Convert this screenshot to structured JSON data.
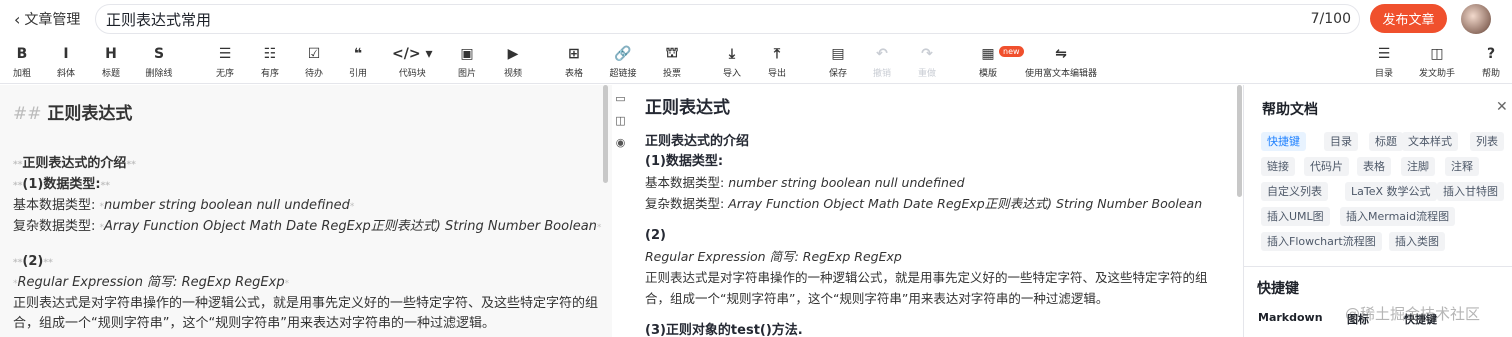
{
  "header": {
    "back_label": "文章管理",
    "title_value": "正则表达式常用",
    "char_count": "7/100",
    "publish_label": "发布文章"
  },
  "toolbar": {
    "items": [
      {
        "icon": "B",
        "label": "加粗",
        "icon_name": "bold-icon"
      },
      {
        "icon": "I",
        "label": "斜体",
        "icon_name": "italic-icon"
      },
      {
        "icon": "H",
        "label": "标题",
        "icon_name": "heading-icon"
      },
      {
        "icon": "S",
        "label": "删除线",
        "icon_name": "strikethrough-icon"
      },
      {
        "icon": "☰",
        "label": "无序",
        "icon_name": "unordered-list-icon"
      },
      {
        "icon": "☷",
        "label": "有序",
        "icon_name": "ordered-list-icon"
      },
      {
        "icon": "☑",
        "label": "待办",
        "icon_name": "todo-list-icon"
      },
      {
        "icon": "❝",
        "label": "引用",
        "icon_name": "quote-icon"
      },
      {
        "icon": "</> ▾",
        "label": "代码块",
        "icon_name": "code-block-icon"
      },
      {
        "icon": "▣",
        "label": "图片",
        "icon_name": "image-icon"
      },
      {
        "icon": "▶",
        "label": "视频",
        "icon_name": "video-icon"
      },
      {
        "icon": "⊞",
        "label": "表格",
        "icon_name": "table-icon"
      },
      {
        "icon": "🔗",
        "label": "超链接",
        "icon_name": "link-icon"
      },
      {
        "icon": "⛫",
        "label": "投票",
        "icon_name": "vote-icon"
      },
      {
        "icon": "⤓",
        "label": "导入",
        "icon_name": "import-icon"
      },
      {
        "icon": "⤒",
        "label": "导出",
        "icon_name": "export-icon"
      },
      {
        "icon": "▤",
        "label": "保存",
        "icon_name": "save-icon"
      },
      {
        "icon": "↶",
        "label": "撤销",
        "icon_name": "undo-icon"
      },
      {
        "icon": "↷",
        "label": "重做",
        "icon_name": "redo-icon"
      },
      {
        "icon": "▦",
        "label": "模版",
        "icon_name": "template-icon"
      },
      {
        "icon": "⇋",
        "label": "使用富文本编辑器",
        "icon_name": "rich-text-icon"
      },
      {
        "icon": "☰",
        "label": "目录",
        "icon_name": "toc-icon"
      },
      {
        "icon": "◫",
        "label": "发文助手",
        "icon_name": "assistant-icon"
      },
      {
        "icon": "?",
        "label": "帮助",
        "icon_name": "help-icon"
      }
    ],
    "new_badge": "new"
  },
  "editor": {
    "heading_marker": "##",
    "heading": "正则表达式",
    "lines": [
      {
        "pre": "**",
        "text": "正则表达式的介绍",
        "post": "**"
      },
      {
        "pre": "**",
        "text": "(1)数据类型:",
        "post": "**"
      },
      {
        "label": "基本数据类型: ",
        "pre": "*",
        "text": "number string boolean null undefined",
        "post": "*"
      },
      {
        "label": "复杂数据类型: ",
        "pre": "*",
        "text": "Array Function Object Math Date RegExp正则表达式) String Number Boolean",
        "post": "*"
      },
      {
        "pre": "**",
        "text": "(2)",
        "post": "**"
      },
      {
        "pre": "*",
        "text": "Regular Expression    简写: RegExp  RegExp",
        "post": "*"
      },
      {
        "text": "正则表达式是对字符串操作的一种逻辑公式，就是用事先定义好的一些特定字符、及这些特定字符的组"
      },
      {
        "text": "合，组成一个“规则字符串”，这个“规则字符串”用来表达对字符串的一种过滤逻辑。"
      }
    ]
  },
  "preview": {
    "h1": "正则表达式",
    "intro_heading": "正则表达式的介绍",
    "sub1": "(1)数据类型:",
    "basic_label": "基本数据类型: ",
    "basic_value": "number string boolean null undefined",
    "complex_label": "复杂数据类型: ",
    "complex_value": "Array Function Object Math Date RegExp正则表达式) String Number Boolean",
    "sub2": "(2)",
    "regex_line": "Regular Expression 简写: RegExp RegExp",
    "desc1": "正则表达式是对字符串操作的一种逻辑公式，就是用事先定义好的一些特定字符、及这些特定字符的组",
    "desc2": "合，组成一个“规则字符串”，这个“规则字符串”用来表达对字符串的一种过滤逻辑。",
    "sub3": "(3)正则对象的test()方法."
  },
  "help": {
    "title": "帮助文档",
    "tags": [
      "快捷键",
      "目录",
      "标题",
      "文本样式",
      "列表",
      "链接",
      "代码片",
      "表格",
      "注脚",
      "注释",
      "自定义列表",
      "LaTeX 数学公式",
      "插入甘特图",
      "插入UML图",
      "插入Mermaid流程图",
      "插入Flowchart流程图",
      "插入类图"
    ],
    "shortcuts_title": "快捷键",
    "col_markdown": "Markdown",
    "col_icon": "图标",
    "col_shortcut": "快捷键"
  },
  "watermark": "@稀土掘金技术社区"
}
